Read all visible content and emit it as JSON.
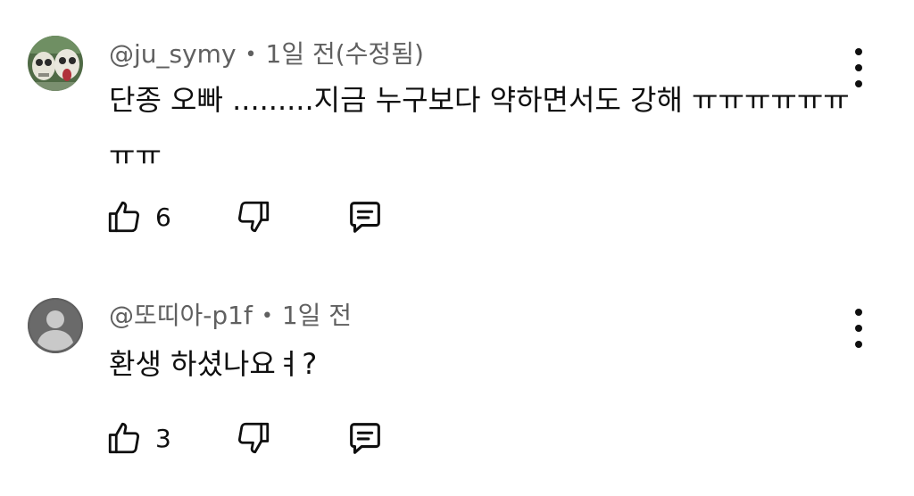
{
  "comments": [
    {
      "author": "@ju_symy",
      "separator": "•",
      "time": "1일 전(수정됨)",
      "text": "단종 오빠 .........지금 누구보다 약하면서도 강해 ㅠㅠㅠㅠㅠㅠㅠㅠ",
      "likes": "6",
      "avatar_icon": "cartoon-characters-avatar"
    },
    {
      "author": "@또띠아-p1f",
      "separator": "•",
      "time": "1일 전",
      "text": "환생 하셨나요ㅕ?",
      "likes": "3",
      "avatar_icon": "default-user-avatar"
    }
  ],
  "colors": {
    "text": "#0f0f0f",
    "meta": "#606060",
    "default_avatar_bg": "#6a6a6a"
  }
}
